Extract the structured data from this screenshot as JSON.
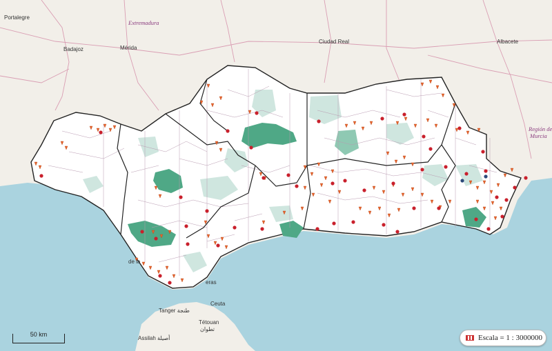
{
  "place_labels": [
    {
      "id": "portalegre",
      "text": "Portalegre"
    },
    {
      "id": "extremadura",
      "text": "Extremadura"
    },
    {
      "id": "badajoz",
      "text": "Badajoz"
    },
    {
      "id": "merida",
      "text": "Mérida"
    },
    {
      "id": "ciudad-real",
      "text": "Ciudad Real"
    },
    {
      "id": "albacete",
      "text": "Albacete"
    },
    {
      "id": "region-murcia-1",
      "text": "Región de"
    },
    {
      "id": "region-murcia-2",
      "text": "Murcia"
    },
    {
      "id": "ceuta",
      "text": "Ceuta"
    },
    {
      "id": "tanger",
      "text": "Tanger طنجة"
    },
    {
      "id": "tetouan",
      "text": "Tétouan"
    },
    {
      "id": "tetouan-ar",
      "text": "تطوان"
    },
    {
      "id": "assilah",
      "text": "Assilah أصيلة"
    },
    {
      "id": "de-la",
      "text": "de la"
    },
    {
      "id": "gibraltar-fragment",
      "text": "eras"
    }
  ],
  "scale_bar": {
    "label": "50 km"
  },
  "legend": {
    "label": "Escala = 1 : 3000000"
  },
  "colors": {
    "sea": "#aad3df",
    "land": "#f2efe9",
    "municipality_fill": "#ffffff",
    "choropleth_light": "#cfe6df",
    "choropleth_mid": "#8fc9b3",
    "choropleth_dark": "#4fa886",
    "province_border": "#222222",
    "municipality_border": "#b89ab0",
    "marker_triangle": "#e8642c",
    "marker_pin": "#c9202c",
    "marker_pin_blue": "#2c4a7a"
  }
}
